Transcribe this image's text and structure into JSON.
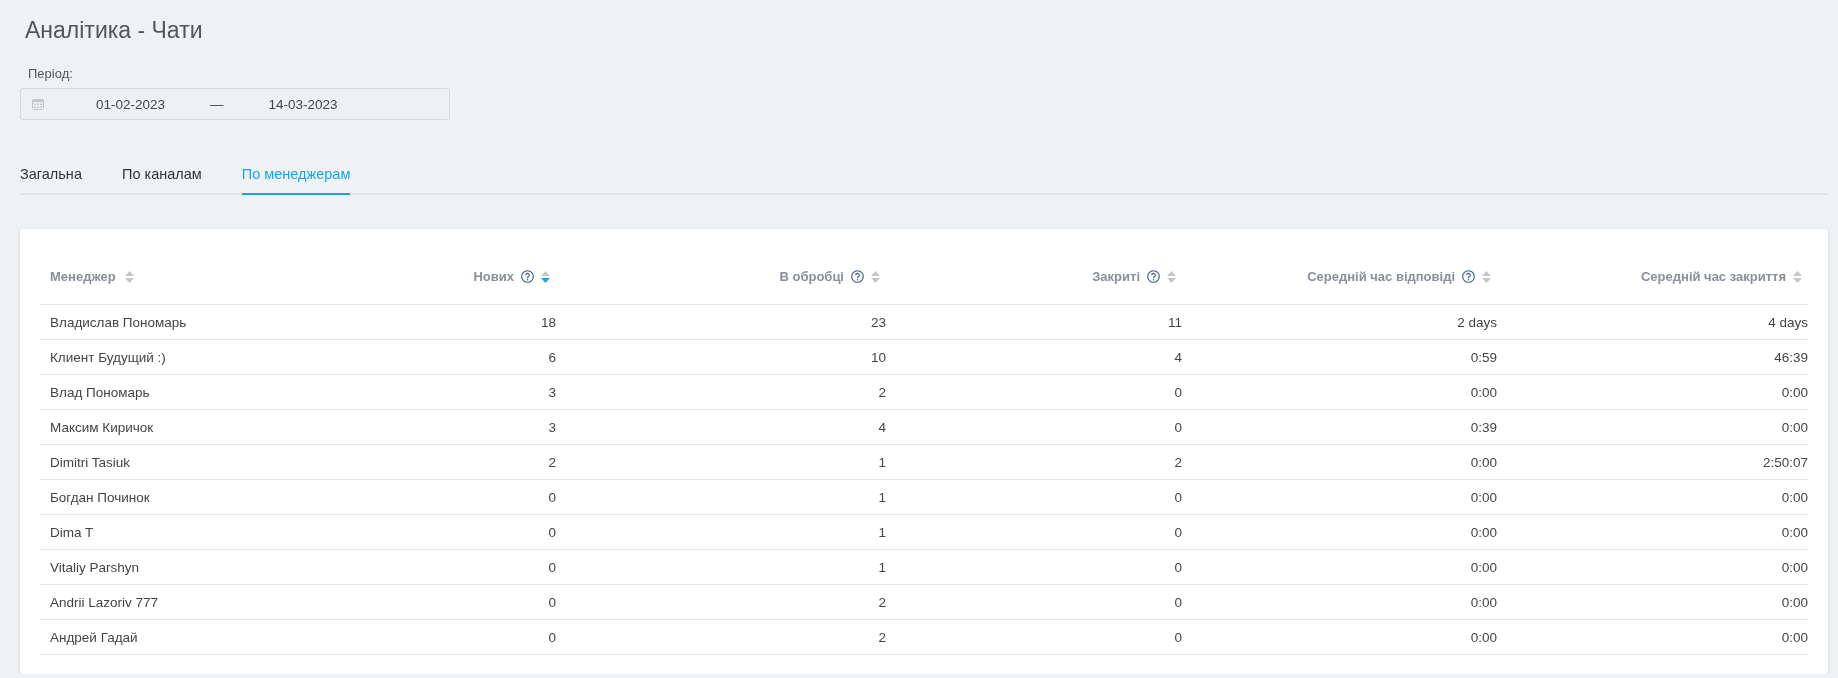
{
  "title": "Аналітика - Чати",
  "period": {
    "label": "Період:",
    "from": "01-02-2023",
    "separator": "—",
    "to": "14-03-2023"
  },
  "tabs": [
    {
      "label": "Загальна",
      "selected": false
    },
    {
      "label": "По каналам",
      "selected": false
    },
    {
      "label": "По менеджерам",
      "selected": true
    }
  ],
  "table": {
    "columns": [
      {
        "label": "Менеджер",
        "help": false,
        "sorted": false
      },
      {
        "label": "Нових",
        "help": true,
        "sorted": true
      },
      {
        "label": "В обробці",
        "help": true,
        "sorted": false
      },
      {
        "label": "Закриті",
        "help": true,
        "sorted": false
      },
      {
        "label": "Середній час відповіді",
        "help": true,
        "sorted": false
      },
      {
        "label": "Середній час закриття",
        "help": false,
        "sorted": false
      }
    ],
    "rows": [
      [
        "Владислав Пономарь",
        "18",
        "23",
        "11",
        "2 days",
        "4 days"
      ],
      [
        "Клиент Будущий :)",
        "6",
        "10",
        "4",
        "0:59",
        "46:39"
      ],
      [
        "Влад Пономарь",
        "3",
        "2",
        "0",
        "0:00",
        "0:00"
      ],
      [
        "Максим Киричок",
        "3",
        "4",
        "0",
        "0:39",
        "0:00"
      ],
      [
        "Dimitri Tasiuk",
        "2",
        "1",
        "2",
        "0:00",
        "2:50:07"
      ],
      [
        "Богдан Починок",
        "0",
        "1",
        "0",
        "0:00",
        "0:00"
      ],
      [
        "Dima T",
        "0",
        "1",
        "0",
        "0:00",
        "0:00"
      ],
      [
        "Vitaliy Parshyn",
        "0",
        "1",
        "0",
        "0:00",
        "0:00"
      ],
      [
        "Andrii Lazoriv 777",
        "0",
        "2",
        "0",
        "0:00",
        "0:00"
      ],
      [
        "Андрей Гадай",
        "0",
        "2",
        "0",
        "0:00",
        "0:00"
      ]
    ]
  }
}
